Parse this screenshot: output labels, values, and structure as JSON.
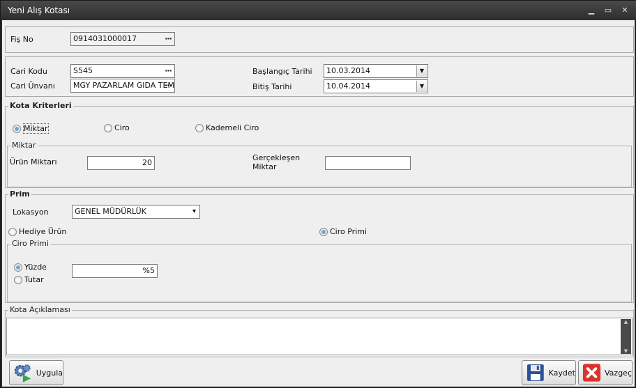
{
  "window": {
    "title": "Yeni Alış Kotası",
    "minimize": "▁",
    "maximize": "▭",
    "close": "✕"
  },
  "fis": {
    "label": "Fiş No",
    "value": "0914031000017",
    "btn": "···"
  },
  "cari": {
    "kod_label": "Cari Kodu",
    "kod_value": "S545",
    "unvan_label": "Cari Ünvanı",
    "unvan_value": "MGY PAZARLAM GIDA TEM",
    "btn": "···"
  },
  "tarih": {
    "baslangic_label": "Başlangıç Tarihi",
    "baslangic_value": "10.03.2014",
    "bitis_label": "Bitiş Tarihi",
    "bitis_value": "10.04.2014",
    "arrow": "▼"
  },
  "kota": {
    "title": "Kota Kriterleri",
    "options": [
      "Miktar",
      "Ciro",
      "Kademeli Ciro"
    ],
    "selected": "Miktar"
  },
  "miktar": {
    "title": "Miktar",
    "urun_label": "Ürün Miktarı",
    "urun_value": "20",
    "gerceklesen_label": "Gerçekleşen Miktar",
    "gerceklesen_value": ""
  },
  "prim": {
    "title": "Prim",
    "lokasyon_label": "Lokasyon",
    "lokasyon_value": "GENEL MÜDÜRLÜK",
    "lokasyon_arrow": "▾",
    "hediye": "Hediye Ürün",
    "ciro": "Ciro Primi",
    "selected": "Ciro Primi"
  },
  "ciro_primi": {
    "title": "Ciro Primi",
    "yuzde": "Yüzde",
    "tutar": "Tutar",
    "selected": "Yüzde",
    "value": "%5"
  },
  "aciklama": {
    "title": "Kota Açıklaması",
    "value": ""
  },
  "buttons": {
    "uygula": "Uygula",
    "kaydet": "Kaydet",
    "vazgec": "Vazgeç"
  },
  "colors": {
    "radio_selected": "#6aa8d8",
    "title_bg": "#2e2e2e",
    "close_red": "#d9342b"
  },
  "icons": {
    "uygula": "gears-play-icon",
    "kaydet": "floppy-disk-icon",
    "vazgec": "red-x-icon"
  }
}
